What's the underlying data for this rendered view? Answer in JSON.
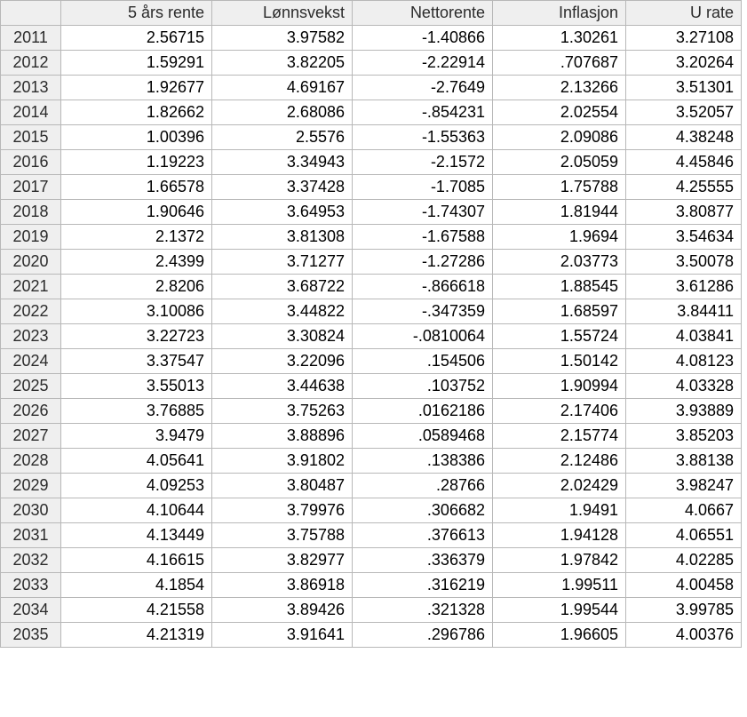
{
  "table": {
    "columns": [
      "5 års rente",
      "Lønnsvekst",
      "Nettorente",
      "Inflasjon",
      "U rate"
    ],
    "rows": [
      {
        "year": "2011",
        "values": [
          "2.56715",
          "3.97582",
          "-1.40866",
          "1.30261",
          "3.27108"
        ]
      },
      {
        "year": "2012",
        "values": [
          "1.59291",
          "3.82205",
          "-2.22914",
          ".707687",
          "3.20264"
        ]
      },
      {
        "year": "2013",
        "values": [
          "1.92677",
          "4.69167",
          "-2.7649",
          "2.13266",
          "3.51301"
        ]
      },
      {
        "year": "2014",
        "values": [
          "1.82662",
          "2.68086",
          "-.854231",
          "2.02554",
          "3.52057"
        ]
      },
      {
        "year": "2015",
        "values": [
          "1.00396",
          "2.5576",
          "-1.55363",
          "2.09086",
          "4.38248"
        ]
      },
      {
        "year": "2016",
        "values": [
          "1.19223",
          "3.34943",
          "-2.1572",
          "2.05059",
          "4.45846"
        ]
      },
      {
        "year": "2017",
        "values": [
          "1.66578",
          "3.37428",
          "-1.7085",
          "1.75788",
          "4.25555"
        ]
      },
      {
        "year": "2018",
        "values": [
          "1.90646",
          "3.64953",
          "-1.74307",
          "1.81944",
          "3.80877"
        ]
      },
      {
        "year": "2019",
        "values": [
          "2.1372",
          "3.81308",
          "-1.67588",
          "1.9694",
          "3.54634"
        ]
      },
      {
        "year": "2020",
        "values": [
          "2.4399",
          "3.71277",
          "-1.27286",
          "2.03773",
          "3.50078"
        ]
      },
      {
        "year": "2021",
        "values": [
          "2.8206",
          "3.68722",
          "-.866618",
          "1.88545",
          "3.61286"
        ]
      },
      {
        "year": "2022",
        "values": [
          "3.10086",
          "3.44822",
          "-.347359",
          "1.68597",
          "3.84411"
        ]
      },
      {
        "year": "2023",
        "values": [
          "3.22723",
          "3.30824",
          "-.0810064",
          "1.55724",
          "4.03841"
        ]
      },
      {
        "year": "2024",
        "values": [
          "3.37547",
          "3.22096",
          ".154506",
          "1.50142",
          "4.08123"
        ]
      },
      {
        "year": "2025",
        "values": [
          "3.55013",
          "3.44638",
          ".103752",
          "1.90994",
          "4.03328"
        ]
      },
      {
        "year": "2026",
        "values": [
          "3.76885",
          "3.75263",
          ".0162186",
          "2.17406",
          "3.93889"
        ]
      },
      {
        "year": "2027",
        "values": [
          "3.9479",
          "3.88896",
          ".0589468",
          "2.15774",
          "3.85203"
        ]
      },
      {
        "year": "2028",
        "values": [
          "4.05641",
          "3.91802",
          ".138386",
          "2.12486",
          "3.88138"
        ]
      },
      {
        "year": "2029",
        "values": [
          "4.09253",
          "3.80487",
          ".28766",
          "2.02429",
          "3.98247"
        ]
      },
      {
        "year": "2030",
        "values": [
          "4.10644",
          "3.79976",
          ".306682",
          "1.9491",
          "4.0667"
        ]
      },
      {
        "year": "2031",
        "values": [
          "4.13449",
          "3.75788",
          ".376613",
          "1.94128",
          "4.06551"
        ]
      },
      {
        "year": "2032",
        "values": [
          "4.16615",
          "3.82977",
          ".336379",
          "1.97842",
          "4.02285"
        ]
      },
      {
        "year": "2033",
        "values": [
          "4.1854",
          "3.86918",
          ".316219",
          "1.99511",
          "4.00458"
        ]
      },
      {
        "year": "2034",
        "values": [
          "4.21558",
          "3.89426",
          ".321328",
          "1.99544",
          "3.99785"
        ]
      },
      {
        "year": "2035",
        "values": [
          "4.21319",
          "3.91641",
          ".296786",
          "1.96605",
          "4.00376"
        ]
      }
    ]
  }
}
